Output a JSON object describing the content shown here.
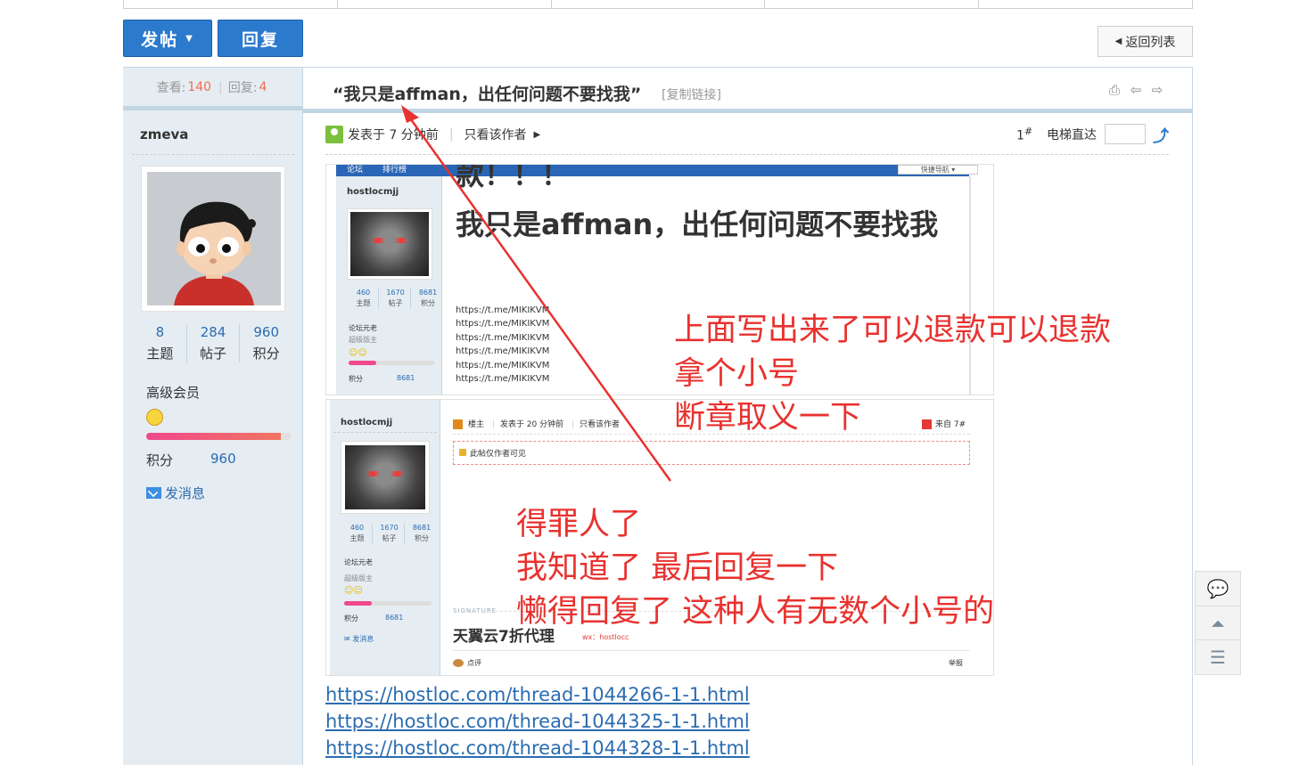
{
  "toolbar": {
    "post_label": "发帖",
    "reply_label": "回复",
    "back_label": "返回列表"
  },
  "thread": {
    "views_label": "查看:",
    "views": "140",
    "replies_label": "回复:",
    "replies": "4",
    "title": "“我只是affman，出任何问题不要找我”",
    "copy_link": "[复制链接]"
  },
  "author": {
    "name": "zmeva",
    "stats": [
      {
        "value": "8",
        "label": "主题"
      },
      {
        "value": "284",
        "label": "帖子"
      },
      {
        "value": "960",
        "label": "积分"
      }
    ],
    "rank": "高级会员",
    "progress": 0.93,
    "score_label": "积分",
    "score": "960",
    "message": "发消息"
  },
  "post_meta": {
    "posted": "发表于 7 分钟前",
    "only_author": "只看该作者",
    "floor": "1",
    "floor_mark": "#",
    "elevator": "电梯直达"
  },
  "shot1": {
    "nav": [
      "论坛",
      "排行榜"
    ],
    "nav_button": "快捷导航 ▾",
    "user": "hostlocmjj",
    "stats": [
      {
        "value": "460",
        "label": "主题"
      },
      {
        "value": "1670",
        "label": "帖子"
      },
      {
        "value": "8681",
        "label": "积分"
      }
    ],
    "rank": "论坛元老",
    "rank2": "超级版主",
    "score_label": "积分",
    "score": "8681",
    "big1": "款！！！",
    "big2": "我只是affman，出任何问题不要找我",
    "links": [
      "https://t.me/MIKIKVM",
      "https://t.me/MIKIKVM",
      "https://t.me/MIKIKVM",
      "https://t.me/MIKIKVM",
      "https://t.me/MIKIKVM",
      "https://t.me/MIKIKVM"
    ]
  },
  "shot2": {
    "user": "hostlocmjj",
    "stats": [
      {
        "value": "460",
        "label": "主题"
      },
      {
        "value": "1670",
        "label": "帖子"
      },
      {
        "value": "8681",
        "label": "积分"
      }
    ],
    "rank": "论坛元老",
    "rank2": "超级版主",
    "score_label": "积分",
    "score": "8681",
    "message": "发消息",
    "meta_owner": "楼主",
    "meta_posted": "发表于 20 分钟前",
    "meta_only": "只看该作者",
    "floor": "来自 7#",
    "locked": "此帖仅作者可见",
    "signature": "SIGNATURE",
    "ad": "天翼云7折代理",
    "wx": "wx：hostlocc",
    "review": "点评",
    "report": "举报"
  },
  "annotations": {
    "block1": [
      "上面写出来了可以退款可以退款",
      "拿个小号",
      "断章取义一下"
    ],
    "block2": [
      "得罪人了",
      "我知道了 最后回复一下",
      "懒得回复了 这种人有无数个小号的"
    ]
  },
  "links": [
    "https://hostloc.com/thread-1044266-1-1.html",
    "https://hostloc.com/thread-1044325-1-1.html",
    "https://hostloc.com/thread-1044328-1-1.html"
  ],
  "colors": {
    "accent": "#2b7acd",
    "annotation": "#e8322f",
    "sidebar": "#e5edf2"
  },
  "icons": [
    "print-icon",
    "prev-thread-icon",
    "next-thread-icon",
    "elevator-go-icon",
    "comment-icon",
    "back-to-top-icon",
    "list-icon",
    "message-icon",
    "smiley-icon",
    "online-status-icon"
  ]
}
